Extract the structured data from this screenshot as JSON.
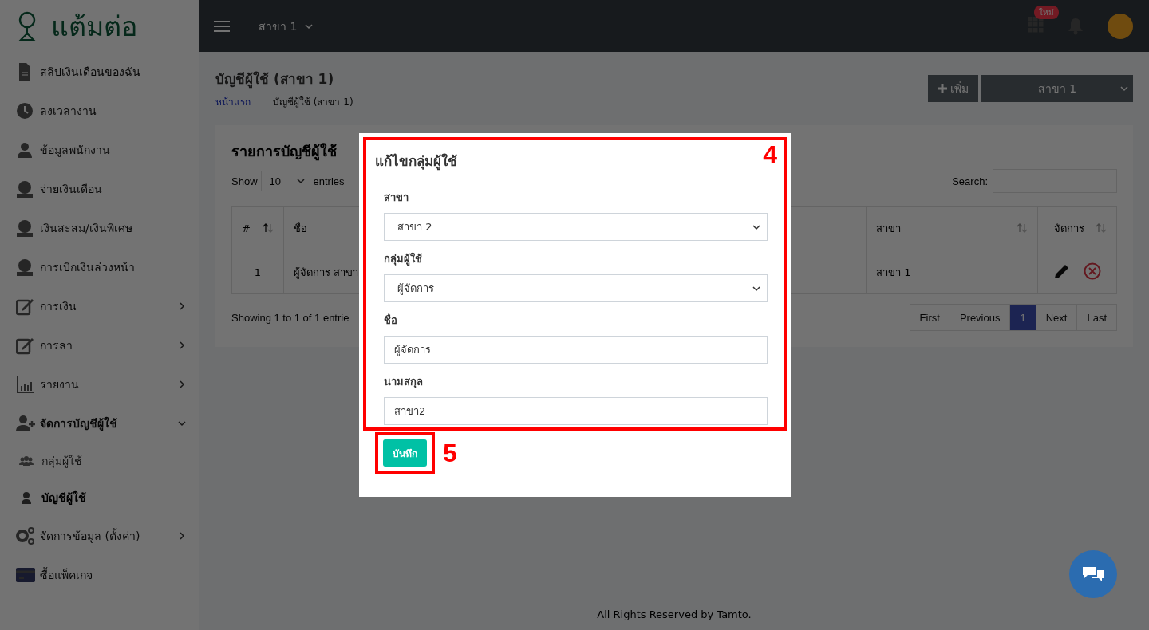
{
  "sidebar": {
    "logo": "แต้มต่อ",
    "items": [
      {
        "label": "สลิปเงินเดือนของฉัน",
        "kind": "link"
      },
      {
        "label": "ลงเวลางาน",
        "kind": "link"
      },
      {
        "label": "ข้อมูลพนักงาน",
        "kind": "link"
      },
      {
        "label": "จ่ายเงินเดือน",
        "kind": "link"
      },
      {
        "label": "เงินสะสม/เงินพิเศษ",
        "kind": "link"
      },
      {
        "label": "การเบิกเงินล่วงหน้า",
        "kind": "link"
      },
      {
        "label": "การเงิน",
        "kind": "group",
        "expanded": false
      },
      {
        "label": "การลา",
        "kind": "group",
        "expanded": false
      },
      {
        "label": "รายงาน",
        "kind": "group",
        "expanded": false
      },
      {
        "label": "จัดการบัญชีผู้ใช้",
        "kind": "group",
        "expanded": true,
        "children": [
          {
            "label": "กลุ่มผู้ใช้",
            "selected": false
          },
          {
            "label": "บัญชีผู้ใช้",
            "selected": true
          }
        ]
      },
      {
        "label": "จัดการข้อมูล (ตั้งค่า)",
        "kind": "group",
        "expanded": false
      },
      {
        "label": "ซื้อแพ็คเกจ",
        "kind": "link"
      }
    ]
  },
  "topbar": {
    "branch": "สาขา 1",
    "badge": "ใหม่"
  },
  "header": {
    "title": "บัญชีผู้ใช้ (สาขา 1)",
    "breadcrumb": [
      "หน้าแรก",
      "บัญชีผู้ใช้ (สาขา 1)"
    ],
    "add_button": "เพิ่ม",
    "branch_select": "สาขา 1"
  },
  "card": {
    "title": "รายการบัญชีผู้ใช้",
    "show_label": "Show",
    "page_size": "10",
    "entries_label": "entries",
    "search_label": "Search:",
    "columns": [
      {
        "label": "#",
        "sorted": true
      },
      {
        "label": "ชื่อ"
      },
      {
        "label": "สาขา",
        "sorted": false
      },
      {
        "label": "จัดการ",
        "sorted": false
      }
    ],
    "rows": [
      {
        "cells": [
          "1",
          "ผู้จัดการ สาขา",
          "สาขา 1"
        ]
      }
    ],
    "info": "Showing 1 to 1 of 1 entrie",
    "pagination": [
      {
        "label": "First",
        "selected": false
      },
      {
        "label": "Previous",
        "selected": false
      },
      {
        "label": "1",
        "selected": true
      },
      {
        "label": "Next",
        "selected": false
      },
      {
        "label": "Last",
        "selected": false
      }
    ]
  },
  "modal": {
    "title": "แก้ไขกลุ่มผู้ใช้",
    "fields": [
      {
        "label": "สาขา",
        "kind": "select",
        "value": "สาขา 2"
      },
      {
        "label": "กลุ่มผู้ใช้",
        "kind": "select",
        "value": "ผู้จัดการ"
      },
      {
        "label": "ชื่อ",
        "kind": "text",
        "value": "ผู้จัดการ"
      },
      {
        "label": "นามสกุล",
        "kind": "text",
        "value": "สาขา2"
      }
    ],
    "save_button": "บันทึก"
  },
  "annotations": [
    {
      "label": "4"
    },
    {
      "label": "5"
    }
  ],
  "footer": "All Rights Reserved by Tamto."
}
